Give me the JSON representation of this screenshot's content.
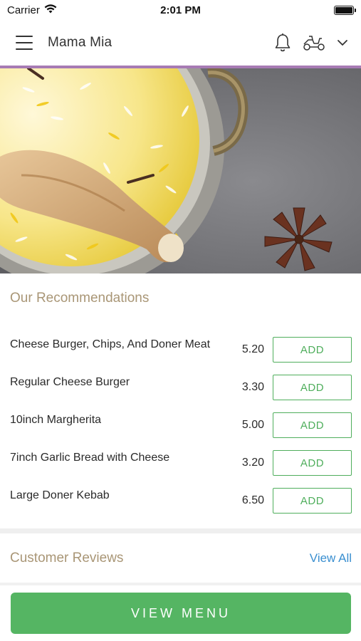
{
  "status_bar": {
    "carrier": "Carrier",
    "time": "2:01 PM"
  },
  "header": {
    "title": "Mama Mia",
    "menu_icon": "hamburger-menu-icon",
    "notification_icon": "bell-icon",
    "delivery_icon": "scooter-icon",
    "dropdown_icon": "chevron-down-icon"
  },
  "hero": {
    "image": "biryani-with-chicken-and-star-anise"
  },
  "recommendations": {
    "title": "Our Recommendations",
    "add_label": "ADD",
    "items": [
      {
        "name": "Cheese Burger, Chips, And Doner Meat",
        "price": "5.20",
        "add_label": "ADD"
      },
      {
        "name": "Regular Cheese Burger",
        "price": "3.30",
        "add_label": "ADD"
      },
      {
        "name": "10inch Margherita",
        "price": "5.00",
        "add_label": "ADD"
      },
      {
        "name": "7inch Garlic Bread with Cheese",
        "price": "3.20",
        "add_label": "ADD"
      },
      {
        "name": "Large Doner Kebab",
        "price": "6.50",
        "add_label": "ADD"
      }
    ]
  },
  "reviews": {
    "title": "Customer Reviews",
    "view_all": "View All"
  },
  "footer": {
    "view_menu_label": "VIEW MENU"
  },
  "colors": {
    "accent_green": "#55b563",
    "section_title": "#a99676",
    "link_blue": "#3a8fd0",
    "header_underline": "#a77bb4"
  }
}
